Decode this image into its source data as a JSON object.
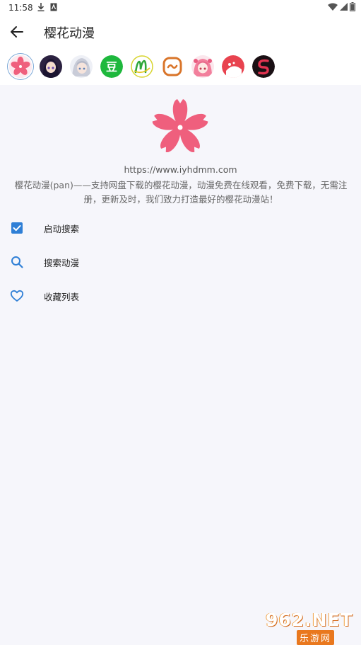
{
  "status_bar": {
    "time": "11:58",
    "download_icon": "download-icon",
    "notification_icon": "notification-icon",
    "wifi_icon": "wifi-icon",
    "signal_icon": "signal-icon",
    "battery_icon": "battery-icon"
  },
  "toolbar": {
    "back_icon": "arrow-back-icon",
    "title": "樱花动漫"
  },
  "sources": [
    {
      "name": "sakura",
      "icon": "sakura-flower-icon",
      "selected": true
    },
    {
      "name": "anime-girl-dark",
      "icon": "anime-avatar-icon"
    },
    {
      "name": "anime-girl-silver",
      "icon": "anime-avatar-icon"
    },
    {
      "name": "dou",
      "icon": "dou-icon",
      "text": "豆"
    },
    {
      "name": "m-logo",
      "icon": "m-logo-icon"
    },
    {
      "name": "wave-logo",
      "icon": "wave-logo-icon"
    },
    {
      "name": "pink-girl",
      "icon": "anime-avatar-icon"
    },
    {
      "name": "red-logo",
      "icon": "red-logo-icon"
    },
    {
      "name": "s-logo",
      "icon": "s-logo-icon"
    }
  ],
  "hero": {
    "icon": "sakura-flower-icon",
    "url": "https://www.iyhdmm.com",
    "description_line1": "樱花动漫(pan)——支持网盘下载的樱花动漫，动漫免费在线观看，免费下载，无需注",
    "description_line2": "册，更新及时，我们致力打造最好的樱花动漫站！"
  },
  "menu": [
    {
      "label": "启动搜索",
      "icon": "checkbox-checked-icon"
    },
    {
      "label": "搜索动漫",
      "icon": "search-icon"
    },
    {
      "label": "收藏列表",
      "icon": "heart-icon"
    }
  ],
  "watermark": {
    "top": "962.NET",
    "bottom": "乐游网"
  },
  "colors": {
    "accent": "#2f7fd6",
    "sakura_pink": "#ef5f7d",
    "background": "#f6f6fb"
  }
}
